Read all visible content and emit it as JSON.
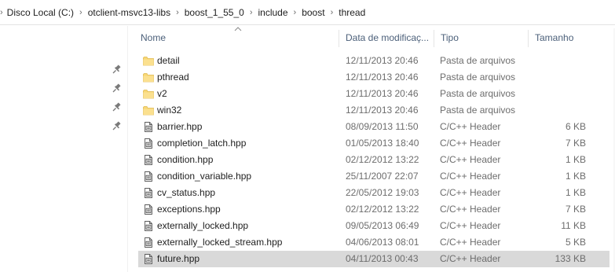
{
  "breadcrumb": [
    {
      "label": "Disco Local (C:)"
    },
    {
      "label": "otclient-msvc13-libs"
    },
    {
      "label": "boost_1_55_0"
    },
    {
      "label": "include"
    },
    {
      "label": "boost"
    },
    {
      "label": "thread"
    }
  ],
  "columns": {
    "name": "Nome",
    "date": "Data de modificaç...",
    "type": "Tipo",
    "size": "Tamanho"
  },
  "sort": {
    "column": "name",
    "direction": "ascending"
  },
  "nav_pins": {
    "count": 4,
    "icon": "pin-icon"
  },
  "files": [
    {
      "icon": "folder-icon",
      "name": "detail",
      "date": "12/11/2013 20:46",
      "type": "Pasta de arquivos",
      "size": "",
      "selected": false
    },
    {
      "icon": "folder-icon",
      "name": "pthread",
      "date": "12/11/2013 20:46",
      "type": "Pasta de arquivos",
      "size": "",
      "selected": false
    },
    {
      "icon": "folder-icon",
      "name": "v2",
      "date": "12/11/2013 20:46",
      "type": "Pasta de arquivos",
      "size": "",
      "selected": false
    },
    {
      "icon": "folder-icon",
      "name": "win32",
      "date": "12/11/2013 20:46",
      "type": "Pasta de arquivos",
      "size": "",
      "selected": false
    },
    {
      "icon": "file-icon",
      "name": "barrier.hpp",
      "date": "08/09/2013 11:50",
      "type": "C/C++ Header",
      "size": "6 KB",
      "selected": false
    },
    {
      "icon": "file-icon",
      "name": "completion_latch.hpp",
      "date": "01/05/2013 18:40",
      "type": "C/C++ Header",
      "size": "7 KB",
      "selected": false
    },
    {
      "icon": "file-icon",
      "name": "condition.hpp",
      "date": "02/12/2012 13:22",
      "type": "C/C++ Header",
      "size": "1 KB",
      "selected": false
    },
    {
      "icon": "file-icon",
      "name": "condition_variable.hpp",
      "date": "25/11/2007 22:07",
      "type": "C/C++ Header",
      "size": "1 KB",
      "selected": false
    },
    {
      "icon": "file-icon",
      "name": "cv_status.hpp",
      "date": "22/05/2012 19:03",
      "type": "C/C++ Header",
      "size": "1 KB",
      "selected": false
    },
    {
      "icon": "file-icon",
      "name": "exceptions.hpp",
      "date": "02/12/2012 13:22",
      "type": "C/C++ Header",
      "size": "7 KB",
      "selected": false
    },
    {
      "icon": "file-icon",
      "name": "externally_locked.hpp",
      "date": "09/05/2013 06:49",
      "type": "C/C++ Header",
      "size": "11 KB",
      "selected": false
    },
    {
      "icon": "file-icon",
      "name": "externally_locked_stream.hpp",
      "date": "04/06/2013 08:01",
      "type": "C/C++ Header",
      "size": "5 KB",
      "selected": false
    },
    {
      "icon": "file-icon",
      "name": "future.hpp",
      "date": "04/11/2013 00:43",
      "type": "C/C++ Header",
      "size": "133 KB",
      "selected": true
    }
  ],
  "colors": {
    "header_text": "#4c607a",
    "folder_yellow": "#f8d775",
    "folder_dark": "#e0b94d",
    "selection": "#d9d9d9",
    "secondary_text": "#6d6d6d"
  }
}
